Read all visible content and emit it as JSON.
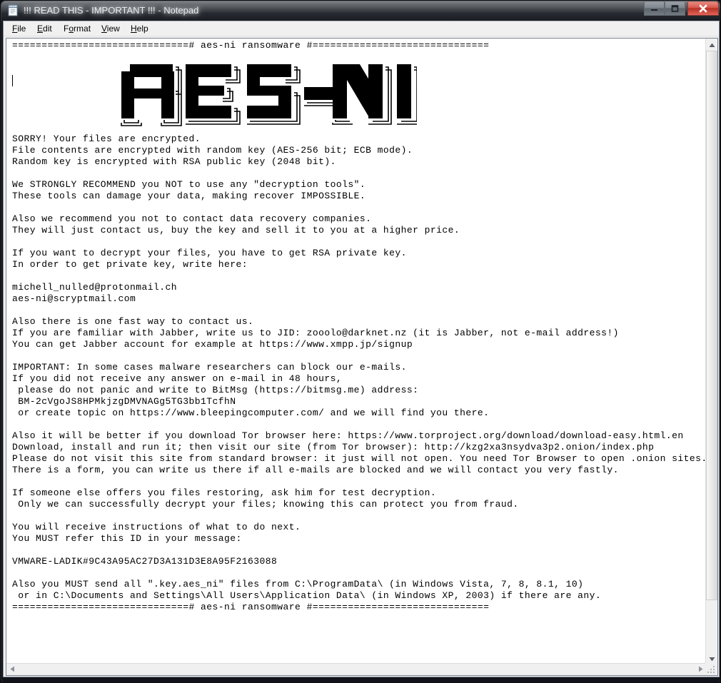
{
  "window": {
    "title": "!!! READ THIS - IMPORTANT !!! - Notepad",
    "icon": "notepad-icon",
    "controls": {
      "minimize_label": "–",
      "maximize_label": "▭",
      "close_label": "✕"
    }
  },
  "menubar": {
    "items": [
      {
        "label": "File",
        "accel": "F"
      },
      {
        "label": "Edit",
        "accel": "E"
      },
      {
        "label": "Format",
        "accel": "o"
      },
      {
        "label": "View",
        "accel": "V"
      },
      {
        "label": "Help",
        "accel": "H"
      }
    ]
  },
  "document": {
    "header_rule": "==============================# aes-ni ransomware #==============================",
    "footer_rule": "==============================# aes-ni ransomware #==============================",
    "logo_text": "AES-NI",
    "body": "SORRY! Your files are encrypted.\nFile contents are encrypted with random key (AES-256 bit; ECB mode).\nRandom key is encrypted with RSA public key (2048 bit).\n\nWe STRONGLY RECOMMEND you NOT to use any \"decryption tools\".\nThese tools can damage your data, making recover IMPOSSIBLE.\n\nAlso we recommend you not to contact data recovery companies.\nThey will just contact us, buy the key and sell it to you at a higher price.\n\nIf you want to decrypt your files, you have to get RSA private key.\nIn order to get private key, write here:\n\nmichell_nulled@protonmail.ch\naes-ni@scryptmail.com\n\nAlso there is one fast way to contact us.\nIf you are familiar with Jabber, write us to JID: zooolo@darknet.nz (it is Jabber, not e-mail address!)\nYou can get Jabber account for example at https://www.xmpp.jp/signup\n\nIMPORTANT: In some cases malware researchers can block our e-mails.\nIf you did not receive any answer on e-mail in 48 hours,\n please do not panic and write to BitMsg (https://bitmsg.me) address:\n BM-2cVgoJS8HPMkjzgDMVNAGg5TG3bb1TcfhN\n or create topic on https://www.bleepingcomputer.com/ and we will find you there.\n\nAlso it will be better if you download Tor browser here: https://www.torproject.org/download/download-easy.html.en\nDownload, install and run it; then visit our site (from Tor browser): http://kzg2xa3nsydva3p2.onion/index.php\nPlease do not visit this site from standard browser: it just will not open. You need Tor Browser to open .onion sites.\nThere is a form, you can write us there if all e-mails are blocked and we will contact you very fastly.\n\nIf someone else offers you files restoring, ask him for test decryption.\n Only we can successfully decrypt your files; knowing this can protect you from fraud.\n\nYou will receive instructions of what to do next.\nYou MUST refer this ID in your message:\n\nVMWARE-LADIK#9C43A95AC27D3A131D3E8A95F2163088\n\nAlso you MUST send all \".key.aes_ni\" files from C:\\ProgramData\\ (in Windows Vista, 7, 8, 8.1, 10)\n or in C:\\Documents and Settings\\All Users\\Application Data\\ (in Windows XP, 2003) if there are any.\n"
  },
  "scrollbars": {
    "v_up_glyph": "▲",
    "v_down_glyph": "▼",
    "h_left_glyph": "◀",
    "h_right_glyph": "▶"
  },
  "colors": {
    "titlebar_dark": "#2c3036",
    "close_red": "#b82f22",
    "client_bg": "#f0f0f0",
    "text_bg": "#ffffff",
    "text_fg": "#000000"
  }
}
